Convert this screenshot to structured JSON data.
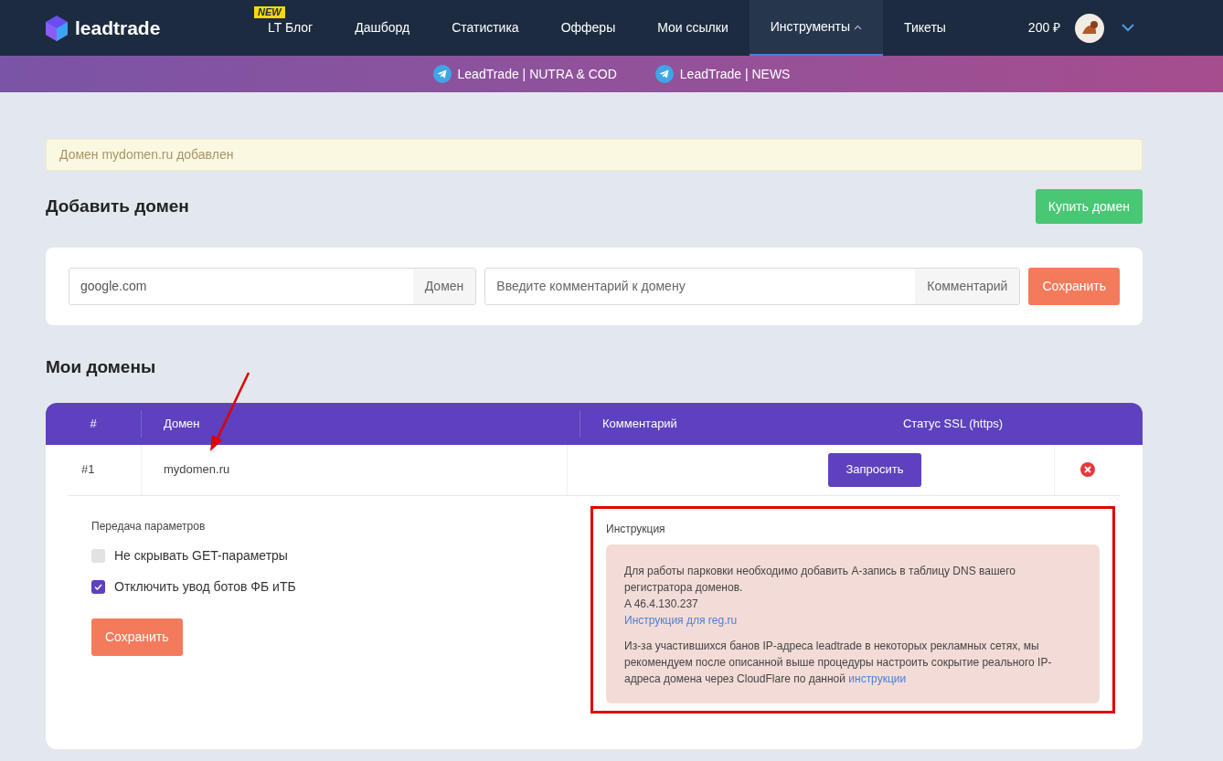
{
  "brand": {
    "name": "leadtrade"
  },
  "nav": [
    {
      "label": "LT Блог",
      "badge": "NEW",
      "selected": false,
      "dropdown": false
    },
    {
      "label": "Дашборд",
      "selected": false,
      "dropdown": false
    },
    {
      "label": "Статистика",
      "selected": false,
      "dropdown": false
    },
    {
      "label": "Офферы",
      "selected": false,
      "dropdown": false
    },
    {
      "label": "Мои ссылки",
      "selected": false,
      "dropdown": false
    },
    {
      "label": "Инструменты",
      "selected": true,
      "dropdown": true
    },
    {
      "label": "Тикеты",
      "selected": false,
      "dropdown": false
    }
  ],
  "balance": "200 ₽",
  "channels": [
    {
      "label": "LeadTrade | NUTRA & COD"
    },
    {
      "label": "LeadTrade | NEWS"
    }
  ],
  "alert": "Домен mydomen.ru добавлен",
  "add_domain": {
    "title": "Добавить домен",
    "buy_button": "Купить домен",
    "domain_field": {
      "value": "google.com",
      "addon": "Домен"
    },
    "comment_field": {
      "placeholder": "Введите комментарий к домену",
      "addon": "Комментарий"
    },
    "save_button": "Сохранить"
  },
  "my_domains": {
    "title": "Мои домены",
    "columns": [
      "#",
      "Домен",
      "Комментарий",
      "Статус SSL (https)"
    ],
    "rows": [
      {
        "number": "#1",
        "domain": "mydomen.ru",
        "ssl_button": "Запросить"
      }
    ],
    "details": {
      "params_title": "Передача параметров",
      "options": [
        {
          "label": "Не скрывать GET-параметры",
          "checked": false
        },
        {
          "label": "Отключить увод ботов ФБ иТБ",
          "checked": true
        }
      ],
      "save_button": "Сохранить",
      "instruction_title": "Инструкция",
      "instruction_text": "Для работы парковки необходимо добавить А-запись в таблицу DNS вашего регистратора доменов.",
      "record": "A 46.4.130.237",
      "instruction_link": "Инструкция для reg.ru",
      "note": "Из-за участившихся банов IP-адреса leadtrade в некоторых рекламных сетях, мы рекомендуем после описанной выше процедуры настроить сокрытие реального IP-адреса домена через CloudFlare по данной",
      "note_link": "инструкции"
    }
  }
}
